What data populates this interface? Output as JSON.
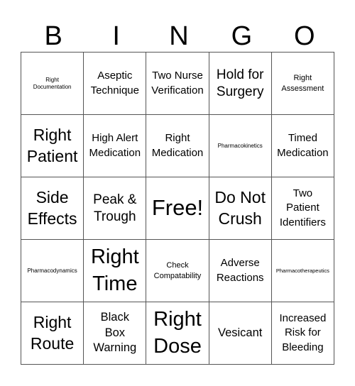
{
  "header": {
    "letters": [
      "B",
      "I",
      "N",
      "G",
      "O"
    ]
  },
  "board": {
    "rows": [
      [
        {
          "text": "Right\nDocumentation",
          "size": "s-xs"
        },
        {
          "text": "Aseptic\nTechnique",
          "size": "s-md"
        },
        {
          "text": "Two Nurse\nVerification",
          "size": "s-md"
        },
        {
          "text": "Hold for\nSurgery",
          "size": "s-xl"
        },
        {
          "text": "Right\nAssessment",
          "size": "s-sm"
        }
      ],
      [
        {
          "text": "Right\nPatient",
          "size": "s-xxl"
        },
        {
          "text": "High Alert\nMedication",
          "size": "s-md"
        },
        {
          "text": "Right\nMedication",
          "size": "s-md"
        },
        {
          "text": "Pharmacokinetics",
          "size": "s-xs"
        },
        {
          "text": "Timed\nMedication",
          "size": "s-md"
        }
      ],
      [
        {
          "text": "Side\nEffects",
          "size": "s-xxl"
        },
        {
          "text": "Peak &\nTrough",
          "size": "s-xl"
        },
        {
          "text": "Free!",
          "size": "s-free"
        },
        {
          "text": "Do Not\nCrush",
          "size": "s-xxl"
        },
        {
          "text": "Two\nPatient\nIdentifiers",
          "size": "s-md"
        }
      ],
      [
        {
          "text": "Pharmacodynamics",
          "size": "s-xs"
        },
        {
          "text": "Right\nTime",
          "size": "s-huge"
        },
        {
          "text": "Check\nCompatability",
          "size": "s-sm"
        },
        {
          "text": "Adverse\nReactions",
          "size": "s-md"
        },
        {
          "text": "Pharmacotherapeutics",
          "size": "s-xxs"
        }
      ],
      [
        {
          "text": "Right\nRoute",
          "size": "s-xxl"
        },
        {
          "text": "Black\nBox\nWarning",
          "size": "s-lg"
        },
        {
          "text": "Right\nDose",
          "size": "s-huge"
        },
        {
          "text": "Vesicant",
          "size": "s-lg"
        },
        {
          "text": "Increased\nRisk for\nBleeding",
          "size": "s-md"
        }
      ]
    ]
  }
}
